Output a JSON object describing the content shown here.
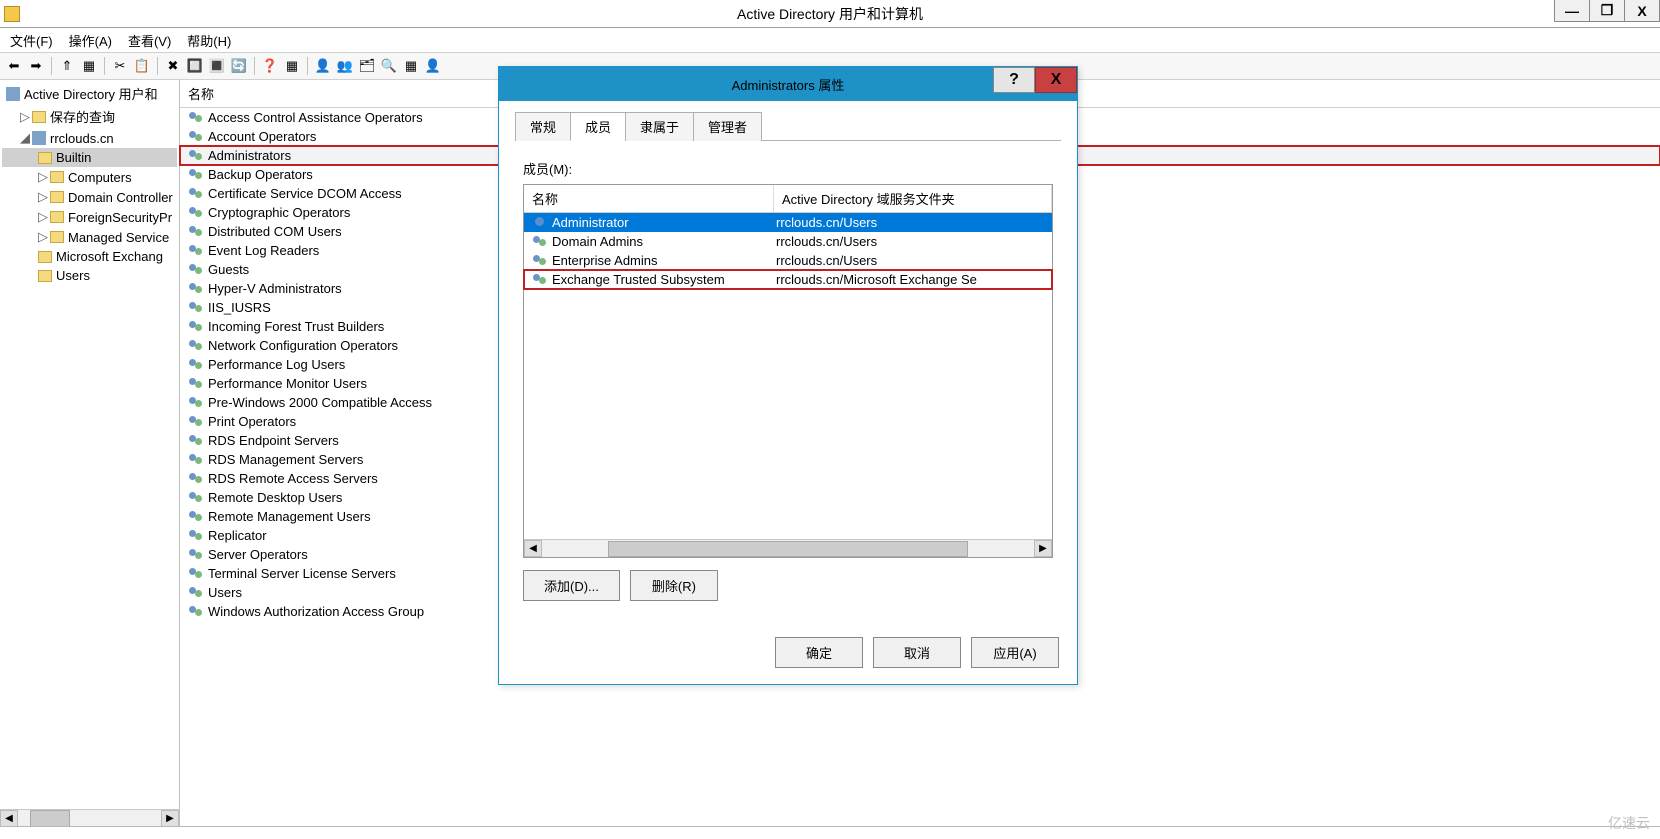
{
  "window": {
    "title": "Active Directory 用户和计算机",
    "btn_min": "—",
    "btn_max": "❐",
    "btn_close": "X"
  },
  "menus": {
    "file": "文件(F)",
    "action": "操作(A)",
    "view": "查看(V)",
    "help": "帮助(H)"
  },
  "toolbar_glyphs": [
    "⬅",
    "➡",
    "⇑",
    "▦",
    "✂",
    "📋",
    "✖",
    "🔲",
    "🔳",
    "🔄",
    "",
    "❓",
    "▦",
    "👤",
    "👥",
    "🗂",
    "🔍",
    "▦",
    "👤"
  ],
  "tree": {
    "root": "Active Directory 用户和",
    "saved_queries": "保存的查询",
    "domain": "rrclouds.cn",
    "builtin": "Builtin",
    "computers": "Computers",
    "domain_controllers": "Domain Controller",
    "foreign": "ForeignSecurityPr",
    "managed": "Managed Service",
    "msexch": "Microsoft Exchang",
    "users": "Users"
  },
  "list_header": "名称",
  "groups": [
    "Access Control Assistance Operators",
    "Account Operators",
    "Administrators",
    "Backup Operators",
    "Certificate Service DCOM Access",
    "Cryptographic Operators",
    "Distributed COM Users",
    "Event Log Readers",
    "Guests",
    "Hyper-V Administrators",
    "IIS_IUSRS",
    "Incoming Forest Trust Builders",
    "Network Configuration Operators",
    "Performance Log Users",
    "Performance Monitor Users",
    "Pre-Windows 2000 Compatible Access",
    "Print Operators",
    "RDS Endpoint Servers",
    "RDS Management Servers",
    "RDS Remote Access Servers",
    "Remote Desktop Users",
    "Remote Management Users",
    "Replicator",
    "Server Operators",
    "Terminal Server License Servers",
    "Users",
    "Windows Authorization Access Group"
  ],
  "dialog": {
    "title": "Administrators 属性",
    "help": "?",
    "close": "X",
    "tabs": {
      "general": "常规",
      "members": "成员",
      "memberof": "隶属于",
      "managedby": "管理者"
    },
    "members_label": "成员(M):",
    "cols": {
      "name": "名称",
      "folder": "Active Directory 域服务文件夹"
    },
    "rows": [
      {
        "icon": "user",
        "name": "Administrator",
        "folder": "rrclouds.cn/Users",
        "selected": true,
        "highlight": false
      },
      {
        "icon": "group",
        "name": "Domain Admins",
        "folder": "rrclouds.cn/Users",
        "selected": false,
        "highlight": false
      },
      {
        "icon": "group",
        "name": "Enterprise Admins",
        "folder": "rrclouds.cn/Users",
        "selected": false,
        "highlight": false
      },
      {
        "icon": "group",
        "name": "Exchange Trusted Subsystem",
        "folder": "rrclouds.cn/Microsoft Exchange Se",
        "selected": false,
        "highlight": true
      }
    ],
    "btn_add": "添加(D)...",
    "btn_remove": "删除(R)",
    "btn_ok": "确定",
    "btn_cancel": "取消",
    "btn_apply": "应用(A)"
  },
  "watermark": "亿速云"
}
